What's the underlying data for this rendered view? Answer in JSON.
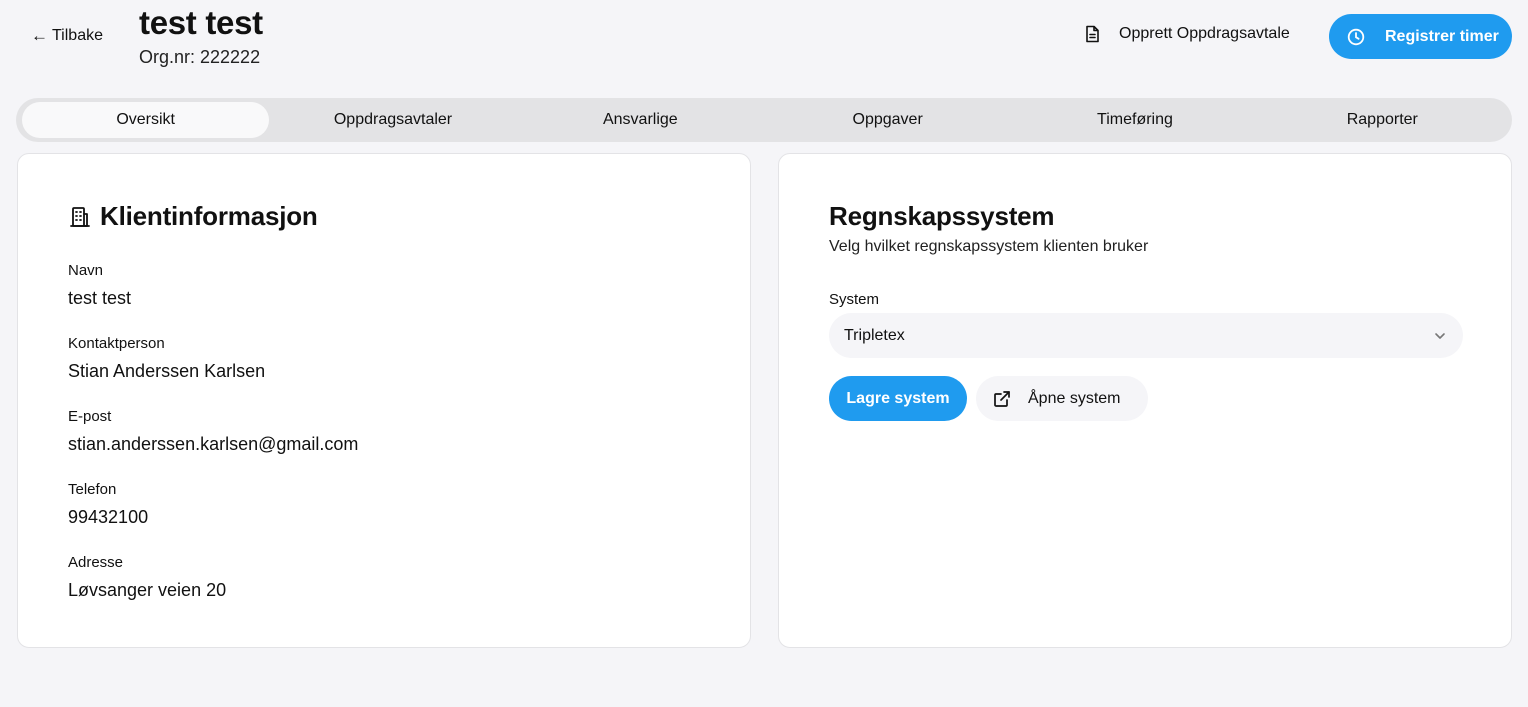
{
  "header": {
    "back_label": "Tilbake",
    "client_name": "test test",
    "org_nr": "Org.nr: 222222",
    "create_agreement_label": "Opprett Oppdragsavtale",
    "register_hours_label": "Registrer timer"
  },
  "tabs": [
    {
      "label": "Oversikt",
      "active": true
    },
    {
      "label": "Oppdragsavtaler",
      "active": false
    },
    {
      "label": "Ansvarlige",
      "active": false
    },
    {
      "label": "Oppgaver",
      "active": false
    },
    {
      "label": "Timeføring",
      "active": false
    },
    {
      "label": "Rapporter",
      "active": false
    }
  ],
  "client_info": {
    "heading": "Klientinformasjon",
    "fields": [
      {
        "label": "Navn",
        "value": "test test"
      },
      {
        "label": "Kontaktperson",
        "value": "Stian Anderssen Karlsen"
      },
      {
        "label": "E-post",
        "value": "stian.anderssen.karlsen@gmail.com"
      },
      {
        "label": "Telefon",
        "value": "99432100"
      },
      {
        "label": "Adresse",
        "value": "Løvsanger veien 20"
      }
    ]
  },
  "accounting": {
    "heading": "Regnskapssystem",
    "subtitle": "Velg hvilket regnskapssystem klienten bruker",
    "system_label": "System",
    "selected_system": "Tripletex",
    "save_label": "Lagre system",
    "open_label": "Åpne system"
  },
  "colors": {
    "primary": "#1f9bef",
    "background": "#f5f5f8",
    "tabbar": "#e3e3e5"
  },
  "icons": {
    "back": "arrow-left-icon",
    "create": "document-icon",
    "register": "clock-icon",
    "client": "building-icon",
    "select": "chevron-down-icon",
    "open": "external-link-icon"
  }
}
